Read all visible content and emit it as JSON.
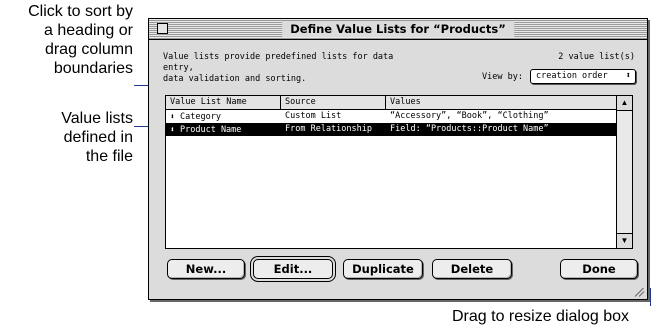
{
  "annotations": {
    "sort": "Click to sort by a heading or drag column boundaries",
    "sort_lines": [
      "Click to sort by",
      "a heading or",
      "drag column",
      "boundaries"
    ],
    "lists_lines": [
      "Value lists",
      "defined in",
      "the file"
    ],
    "resize": "Drag to resize dialog box"
  },
  "dialog": {
    "title": "Define Value Lists for “Products”",
    "info_line1": "Value lists provide predefined lists for data entry,",
    "info_line2": "data validation and sorting.",
    "count": "2 value list(s)",
    "view_by_label": "View by:",
    "view_by_value": "creation order"
  },
  "list": {
    "columns": [
      "Value List Name",
      "Source",
      "Values"
    ],
    "rows": [
      {
        "name": "Category",
        "source": "Custom List",
        "values": "“Accessory”, “Book”, “Clothing”",
        "selected": false
      },
      {
        "name": "Product Name",
        "source": "From Relationship",
        "values": "Field: “Products::Product Name”",
        "selected": true
      }
    ]
  },
  "buttons": {
    "new": "New...",
    "edit": "Edit...",
    "duplicate": "Duplicate",
    "delete": "Delete",
    "done": "Done"
  },
  "icons": {
    "close_box": "close-box-icon",
    "sort_handle": "row-drag-handle-icon",
    "popup_arrows": "updown-arrows-icon",
    "scroll_up": "up-arrow-icon",
    "scroll_down": "down-arrow-icon",
    "grow_box": "resize-grip-icon"
  },
  "colors": {
    "callout_line": "#1f3a8f",
    "dialog_bg": "#dcdcdc",
    "selected_row": "#000000"
  }
}
